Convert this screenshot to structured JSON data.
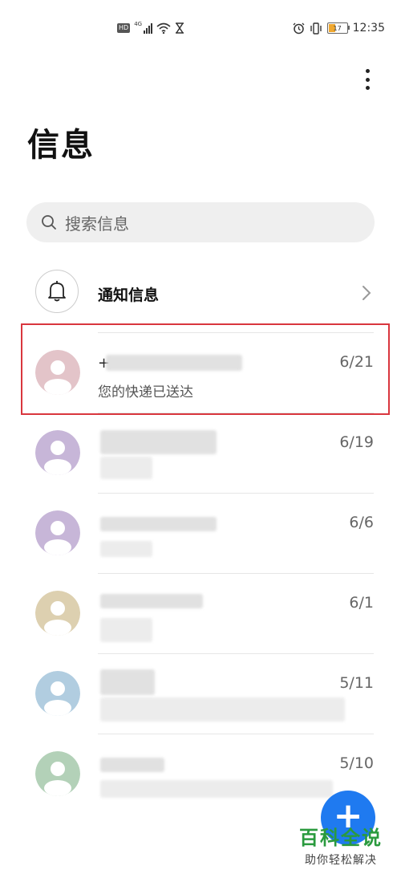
{
  "status_bar": {
    "hd_badge": "HD",
    "network_label": "4G",
    "time": "12:35",
    "battery_level": "17",
    "icons": [
      "hd-icon",
      "signal-icon",
      "wifi-icon",
      "hourglass-icon",
      "alarm-icon",
      "vibrate-icon",
      "battery-icon"
    ]
  },
  "header": {
    "title": "信息",
    "more_icon": "more-vertical-icon"
  },
  "search": {
    "placeholder": "搜索信息"
  },
  "notifications": {
    "label": "通知信息"
  },
  "conversations": [
    {
      "name_prefix": "+",
      "snippet": "您的快递已送达",
      "date": "6/21",
      "avatar_color": "#e3c4c9",
      "highlighted": true
    },
    {
      "date": "6/19",
      "avatar_color": "#c7b6d8"
    },
    {
      "date": "6/6",
      "avatar_color": "#c7b6d8"
    },
    {
      "date": "6/1",
      "avatar_color": "#ddd0b0"
    },
    {
      "date": "5/11",
      "avatar_color": "#b1cde0"
    },
    {
      "date": "5/10",
      "avatar_color": "#b3d1b8"
    }
  ],
  "fab": {
    "label": "+"
  },
  "watermark": {
    "title": "百科全说",
    "subtitle": "助你轻松解决"
  },
  "colors": {
    "accent": "#1f7af0",
    "highlight": "#d9363e",
    "watermark": "#2a9a3e"
  }
}
